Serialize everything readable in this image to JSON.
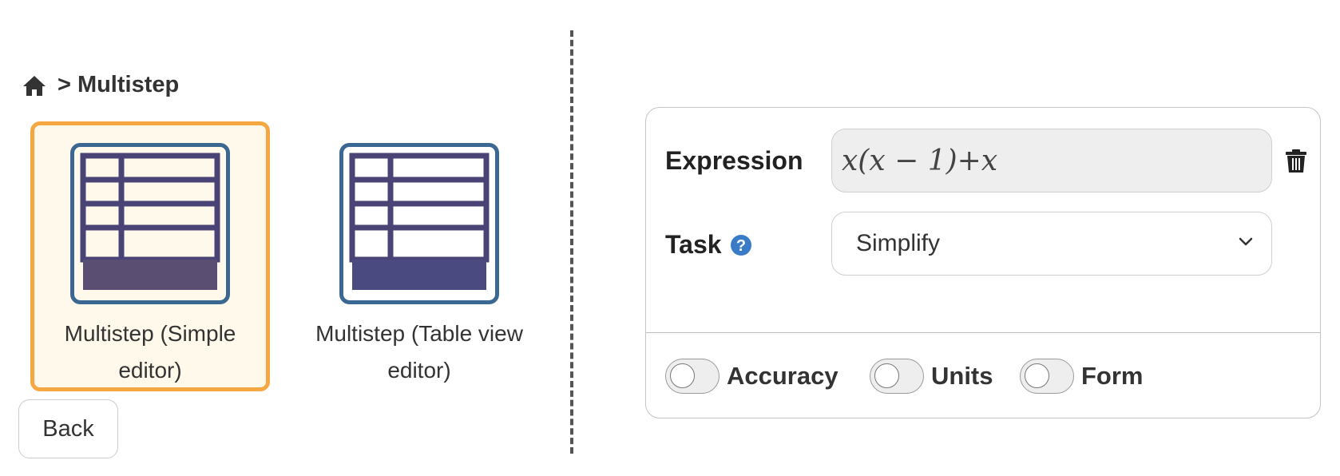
{
  "breadcrumb": {
    "home_icon": "home-icon",
    "separator": ">",
    "current": "Multistep"
  },
  "cards": [
    {
      "label": "Multistep (Simple editor)",
      "icon": "table-grid-icon",
      "selected": true
    },
    {
      "label": "Multistep (Table view editor)",
      "icon": "table-grid-icon",
      "selected": false
    }
  ],
  "back_button": {
    "label": "Back"
  },
  "panel": {
    "expression": {
      "label": "Expression",
      "value": "x(x − 1)+x",
      "delete_icon": "trash-icon"
    },
    "task": {
      "label": "Task",
      "help_icon": "question-circle-icon",
      "selected": "Simplify",
      "dropdown_icon": "chevron-down-icon"
    },
    "toggles": [
      {
        "label": "Accuracy",
        "on": false
      },
      {
        "label": "Units",
        "on": false
      },
      {
        "label": "Form",
        "on": false
      }
    ]
  },
  "colors": {
    "selected_border": "#f5a742",
    "selected_bg": "#fef9ea",
    "icon_frame": "#3a6892",
    "icon_grid": "#4a4375",
    "help_blue": "#3a7bc8"
  }
}
